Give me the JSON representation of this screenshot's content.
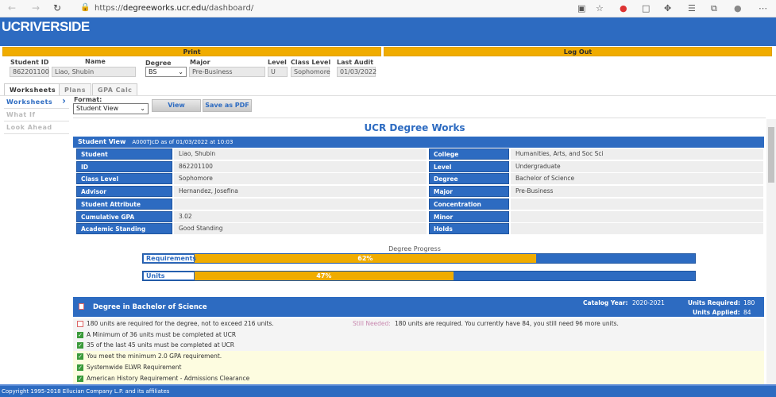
{
  "browser": {
    "url_prefix": "https://",
    "url_host": "degreeworks.ucr.edu",
    "url_path": "/dashboard/"
  },
  "header": {
    "logo": "UCRIVERSIDE",
    "print": "Print",
    "logout": "Log Out"
  },
  "student_bar": {
    "student_id_label": "Student ID",
    "student_id": "862201100",
    "name_label": "Name",
    "name": "Liao, Shubin",
    "degree_label": "Degree",
    "degree": "BS",
    "major_label": "Major",
    "major": "Pre-Business",
    "level_label": "Level",
    "level": "U",
    "class_level_label": "Class Level",
    "class_level": "Sophomore",
    "last_audit_label": "Last Audit",
    "last_audit": "01/03/2022"
  },
  "tabs": [
    {
      "label": "Worksheets",
      "active": true
    },
    {
      "label": "Plans"
    },
    {
      "label": "GPA Calc"
    }
  ],
  "sidebar": [
    {
      "label": "Worksheets",
      "active": true
    },
    {
      "label": "What If"
    },
    {
      "label": "Look Ahead"
    }
  ],
  "toolbar": {
    "format_label": "Format:",
    "format": "Student View",
    "view": "View",
    "save_pdf": "Save as PDF"
  },
  "main": {
    "title": "UCR Degree Works",
    "view_title": "Student View",
    "view_sub": "A000TJcD as of 01/03/2022 at 10:03",
    "left": [
      {
        "k": "Student",
        "v": "Liao, Shubin"
      },
      {
        "k": "ID",
        "v": "862201100"
      },
      {
        "k": "Class Level",
        "v": "Sophomore"
      },
      {
        "k": "Advisor",
        "v": "Hernandez, Josefina"
      },
      {
        "k": "Student Attribute",
        "v": ""
      },
      {
        "k": "Cumulative GPA",
        "v": "3.02"
      },
      {
        "k": "Academic Standing",
        "v": "Good Standing"
      }
    ],
    "right": [
      {
        "k": "College",
        "v": "Humanities, Arts, and Soc Sci"
      },
      {
        "k": "Level",
        "v": "Undergraduate"
      },
      {
        "k": "Degree",
        "v": "Bachelor of Science"
      },
      {
        "k": "Major",
        "v": "Pre-Business"
      },
      {
        "k": "Concentration",
        "v": ""
      },
      {
        "k": "Minor",
        "v": ""
      },
      {
        "k": "Holds",
        "v": ""
      }
    ],
    "progress": {
      "title": "Degree Progress",
      "requirements_label": "Requirements",
      "requirements_pct": 62,
      "requirements_text": "62%",
      "units_label": "Units",
      "units_pct": 47,
      "units_text": "47%"
    },
    "block": {
      "title": "Degree in Bachelor of Science",
      "catalog_label": "Catalog Year:",
      "catalog": "2020-2021",
      "units_req_label": "Units Required:",
      "units_req": "180",
      "units_app_label": "Units Applied:",
      "units_app": "84"
    },
    "requirements": [
      {
        "text": "180 units are required for the degree, not to exceed 216 units.",
        "done": false,
        "still_label": "Still Needed:",
        "still": "180 units are required. You currently have 84, you still need 96 more units."
      },
      {
        "text": "A Minimum of 36 units must be completed at UCR",
        "done": true
      },
      {
        "text": "35 of the last 45 units must be completed at UCR",
        "done": true
      },
      {
        "text": "You meet the minimum 2.0 GPA requirement.",
        "done": true
      },
      {
        "text": "Systemwide ELWR Requirement",
        "done": true
      },
      {
        "text": "American History Requirement - Admissions Clearance",
        "done": true
      }
    ]
  },
  "footer": "Copyright 1995-2018 Ellucian Company L.P. and its affiliates",
  "colors": {
    "primary": "#2d6bc1",
    "accent": "#f0ac00"
  }
}
